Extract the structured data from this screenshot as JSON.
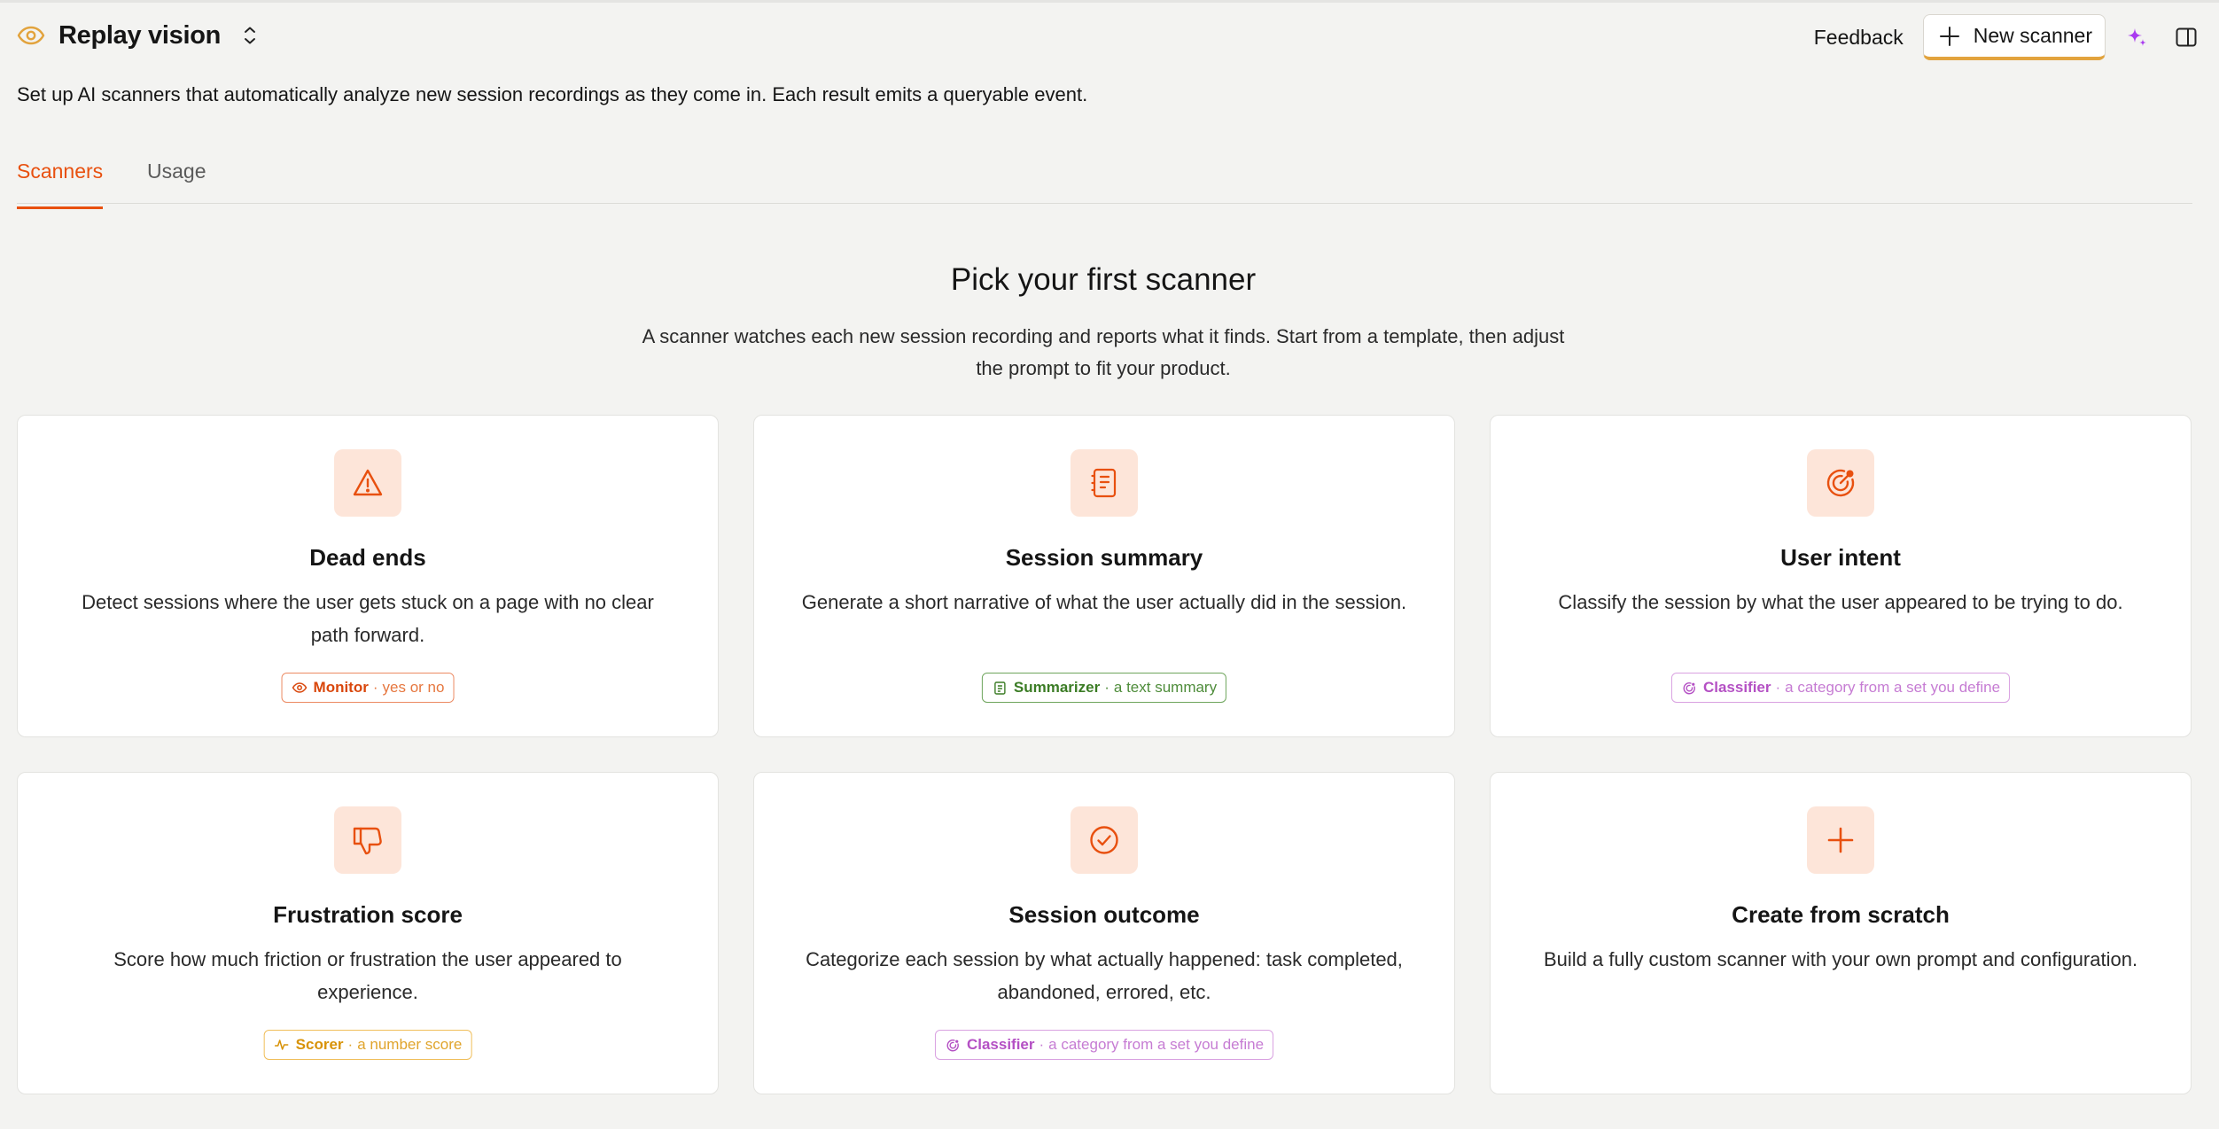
{
  "header": {
    "app_icon": "eye-icon",
    "title": "Replay vision",
    "feedback_label": "Feedback",
    "new_scanner_label": "New scanner"
  },
  "subtitle": "Set up AI scanners that automatically analyze new session recordings as they come in. Each result emits a queryable event.",
  "tabs": [
    {
      "label": "Scanners",
      "active": true
    },
    {
      "label": "Usage",
      "active": false
    }
  ],
  "empty_state": {
    "title": "Pick your first scanner",
    "description": "A scanner watches each new session recording and reports what it finds. Start from a template, then adjust the prompt to fit your product."
  },
  "templates": [
    {
      "icon": "warning-icon",
      "title": "Dead ends",
      "description": "Detect sessions where the user gets stuck on a page with no clear path forward.",
      "badge": {
        "type": "monitor",
        "icon": "eye-icon",
        "name": "Monitor",
        "desc": "yes or no"
      }
    },
    {
      "icon": "notebook-icon",
      "title": "Session summary",
      "description": "Generate a short narrative of what the user actually did in the session.",
      "badge": {
        "type": "summarizer",
        "icon": "notebook-icon",
        "name": "Summarizer",
        "desc": "a text summary"
      }
    },
    {
      "icon": "target-icon",
      "title": "User intent",
      "description": "Classify the session by what the user appeared to be trying to do.",
      "badge": {
        "type": "classifier",
        "icon": "target-icon",
        "name": "Classifier",
        "desc": "a category from a set you define"
      }
    },
    {
      "icon": "thumbs-down-icon",
      "title": "Frustration score",
      "description": "Score how much friction or frustration the user appeared to experience.",
      "badge": {
        "type": "scorer",
        "icon": "pulse-icon",
        "name": "Scorer",
        "desc": "a number score"
      }
    },
    {
      "icon": "check-circle-icon",
      "title": "Session outcome",
      "description": "Categorize each session by what actually happened: task completed, abandoned, errored, etc.",
      "badge": {
        "type": "classifier",
        "icon": "target-icon",
        "name": "Classifier",
        "desc": "a category from a set you define"
      }
    },
    {
      "icon": "plus-icon",
      "title": "Create from scratch",
      "description": "Build a fully custom scanner with your own prompt and configuration."
    }
  ],
  "colors": {
    "accent": "#e8500f",
    "icon_tile_bg": "#fde5d9",
    "page_bg": "#f3f3f1",
    "sparkle": "#a93bf0"
  }
}
